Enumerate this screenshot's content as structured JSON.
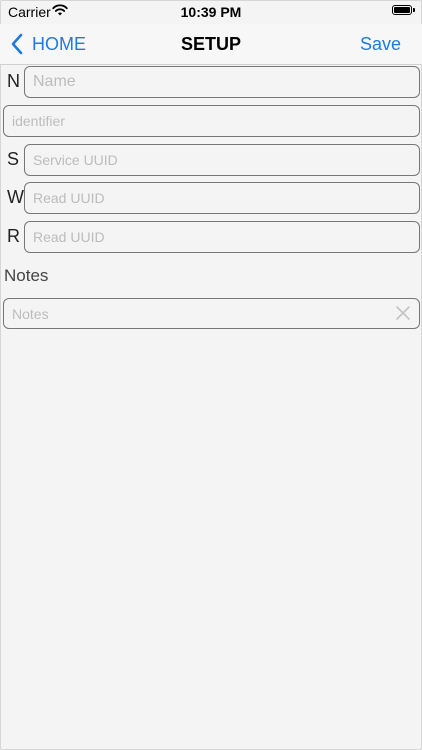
{
  "status_bar": {
    "carrier": "Carrier",
    "time": "10:39 PM",
    "wifi_icon": "wifi-icon",
    "battery_icon": "battery-icon"
  },
  "nav": {
    "back_label": "HOME",
    "back_icon": "chevron-left-icon",
    "title": "SETUP",
    "save_label": "Save",
    "accent_color": "#1f7ae0"
  },
  "form": {
    "name": {
      "letter": "N",
      "placeholder": "Name",
      "value": ""
    },
    "identifier": {
      "placeholder": "identifier",
      "value": ""
    },
    "service": {
      "letter": "S",
      "placeholder": "Service UUID",
      "value": ""
    },
    "write": {
      "letter": "W",
      "placeholder": "Read UUID",
      "value": ""
    },
    "read": {
      "letter": "R",
      "placeholder": "Read UUID",
      "value": ""
    },
    "notes_label": "Notes",
    "notes": {
      "placeholder": "Notes",
      "value": "",
      "clear_icon": "clear-icon"
    }
  }
}
